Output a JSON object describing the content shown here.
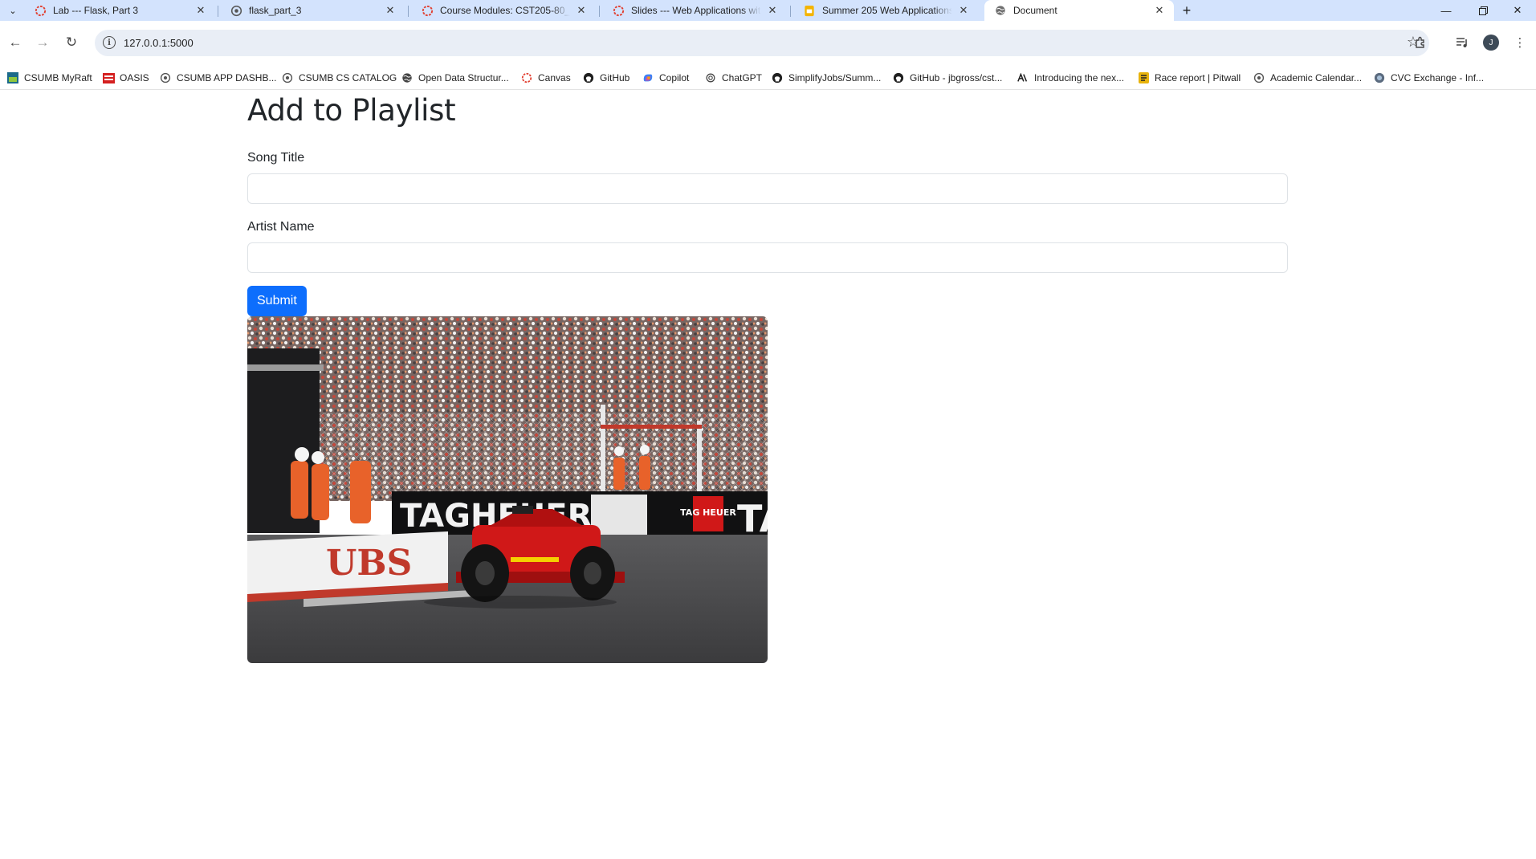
{
  "browser": {
    "tabs": [
      {
        "title": "Lab --- Flask, Part 3",
        "favicon": "canvas-icon"
      },
      {
        "title": "flask_part_3",
        "favicon": "replit-icon"
      },
      {
        "title": "Course Modules: CST205-80_SU",
        "favicon": "canvas-icon"
      },
      {
        "title": "Slides --- Web Applications with",
        "favicon": "canvas-icon"
      },
      {
        "title": "Summer 205 Web Applications",
        "favicon": "slides-icon"
      },
      {
        "title": "Document",
        "favicon": "globe-icon",
        "active": true
      }
    ],
    "address": "127.0.0.1:5000",
    "profile_initial": "J",
    "bookmarks": [
      {
        "label": "CSUMB MyRaft",
        "icon": "myraft-icon"
      },
      {
        "label": "OASIS",
        "icon": "oasis-icon"
      },
      {
        "label": "CSUMB APP DASHB...",
        "icon": "replit-icon"
      },
      {
        "label": "CSUMB CS CATALOG",
        "icon": "replit-icon"
      },
      {
        "label": "Open Data Structur...",
        "icon": "globe-icon"
      },
      {
        "label": "Canvas",
        "icon": "canvas-icon"
      },
      {
        "label": "GitHub",
        "icon": "github-icon"
      },
      {
        "label": "Copilot",
        "icon": "copilot-icon"
      },
      {
        "label": "ChatGPT",
        "icon": "chatgpt-icon"
      },
      {
        "label": "SimplifyJobs/Summ...",
        "icon": "github-icon"
      },
      {
        "label": "GitHub - jbgross/cst...",
        "icon": "github-icon"
      },
      {
        "label": "Introducing the nex...",
        "icon": "anthropic-icon"
      },
      {
        "label": "Race report | Pitwall",
        "icon": "pitwall-icon"
      },
      {
        "label": "Academic Calendar...",
        "icon": "replit-icon"
      },
      {
        "label": "CVC Exchange - Inf...",
        "icon": "cvc-icon"
      }
    ]
  },
  "page": {
    "heading": "Add to Playlist",
    "fields": [
      {
        "label": "Song Title",
        "value": ""
      },
      {
        "label": "Artist Name",
        "value": ""
      }
    ],
    "submit_label": "Submit",
    "image": {
      "subject": "f1-race-car-photo",
      "signage": [
        "TAGHEUER",
        "UBS",
        "TAG HEUER",
        "TA"
      ]
    }
  },
  "colors": {
    "tabstrip": "#d3e3fd",
    "primary": "#0d6efd",
    "car_red": "#d01818"
  }
}
